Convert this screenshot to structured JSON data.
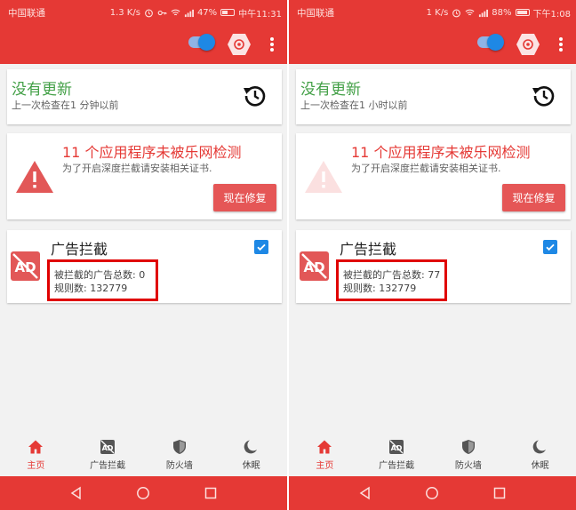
{
  "screens": [
    {
      "status": {
        "carrier": "中国联通 ",
        "speed": "1.3 K/s",
        "battery": "47%",
        "time": "中午11:31",
        "battery_level": 0.47
      },
      "update": {
        "title": "没有更新",
        "subtitle": "上一次检查在1 分钟以前"
      },
      "warning": {
        "title": "11 个应用程序未被乐网检测",
        "subtitle": "为了开启深度拦截请安装相关证书.",
        "button": "现在修复"
      },
      "adblock": {
        "title": "广告拦截",
        "blocked_count": "被拦截的广告总数: 0",
        "rule_count": "规则数: 132779",
        "checked": true
      },
      "nav": [
        {
          "label": "主页",
          "icon": "home-icon",
          "active": true
        },
        {
          "label": "广告拦截",
          "icon": "ad-block-icon",
          "active": false
        },
        {
          "label": "防火墙",
          "icon": "shield-icon",
          "active": false
        },
        {
          "label": "休眠",
          "icon": "moon-icon",
          "active": false
        }
      ]
    },
    {
      "status": {
        "carrier": "中国联通 ",
        "speed": "1 K/s",
        "battery": "88%",
        "time": "下午1:08",
        "battery_level": 0.88
      },
      "update": {
        "title": "没有更新",
        "subtitle": "上一次检查在1 小时以前"
      },
      "warning": {
        "title": "11 个应用程序未被乐网检测",
        "subtitle": "为了开启深度拦截请安装相关证书.",
        "button": "现在修复"
      },
      "adblock": {
        "title": "广告拦截",
        "blocked_count": "被拦截的广告总数: 77",
        "rule_count": "规则数: 132779",
        "checked": true
      },
      "nav": [
        {
          "label": "主页",
          "icon": "home-icon",
          "active": true
        },
        {
          "label": "广告拦截",
          "icon": "ad-block-icon",
          "active": false
        },
        {
          "label": "防火墙",
          "icon": "shield-icon",
          "active": false
        },
        {
          "label": "休眠",
          "icon": "moon-icon",
          "active": false
        }
      ]
    }
  ],
  "colors": {
    "primary": "#e53935",
    "success": "#43a047",
    "accent": "#1e88e5",
    "highlight_box": "#e00000"
  }
}
